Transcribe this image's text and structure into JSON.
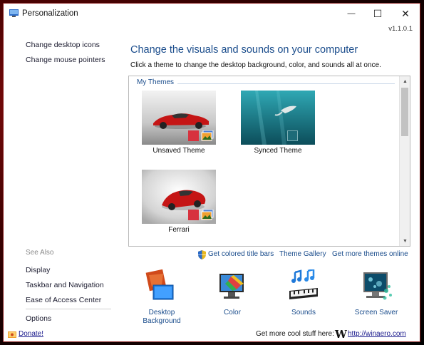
{
  "window": {
    "title": "Personalization",
    "version": "v1.1.0.1"
  },
  "titlebar_buttons": {
    "minimize": "—",
    "maximize": "☐",
    "close": "✕"
  },
  "left_nav": {
    "links": [
      "Change desktop icons",
      "Change mouse pointers"
    ],
    "see_also_title": "See Also",
    "see_also": [
      "Display",
      "Taskbar and Navigation",
      "Ease of Access Center"
    ],
    "options": "Options"
  },
  "main": {
    "heading": "Change the visuals and sounds on your computer",
    "subtext": "Click a theme to change the desktop background, color, and sounds all at once.",
    "group_label": "My Themes",
    "themes": [
      {
        "name": "Unsaved Theme",
        "swatch_color": "#d7323e"
      },
      {
        "name": "Synced Theme",
        "swatch_color": "#1d6b78"
      },
      {
        "name": "Ferrari",
        "swatch_color": "#d7323e"
      }
    ]
  },
  "bottom_links": {
    "colored_title_bars": "Get colored title bars",
    "theme_gallery": "Theme Gallery",
    "more_themes": "Get more themes online"
  },
  "customize": [
    {
      "label_line1": "Desktop",
      "label_line2": "Background",
      "icon": "desktop-background-icon"
    },
    {
      "label_line1": "Color",
      "label_line2": "",
      "icon": "color-icon"
    },
    {
      "label_line1": "Sounds",
      "label_line2": "",
      "icon": "sounds-icon"
    },
    {
      "label_line1": "Screen Saver",
      "label_line2": "",
      "icon": "screen-saver-icon"
    }
  ],
  "footer": {
    "donate": "Donate!",
    "cool_text": "Get more cool stuff here:",
    "w_logo": "W",
    "link": "http://winaero.com"
  },
  "colors": {
    "accent": "#1b4d8c",
    "window_border": "#8a2020"
  }
}
